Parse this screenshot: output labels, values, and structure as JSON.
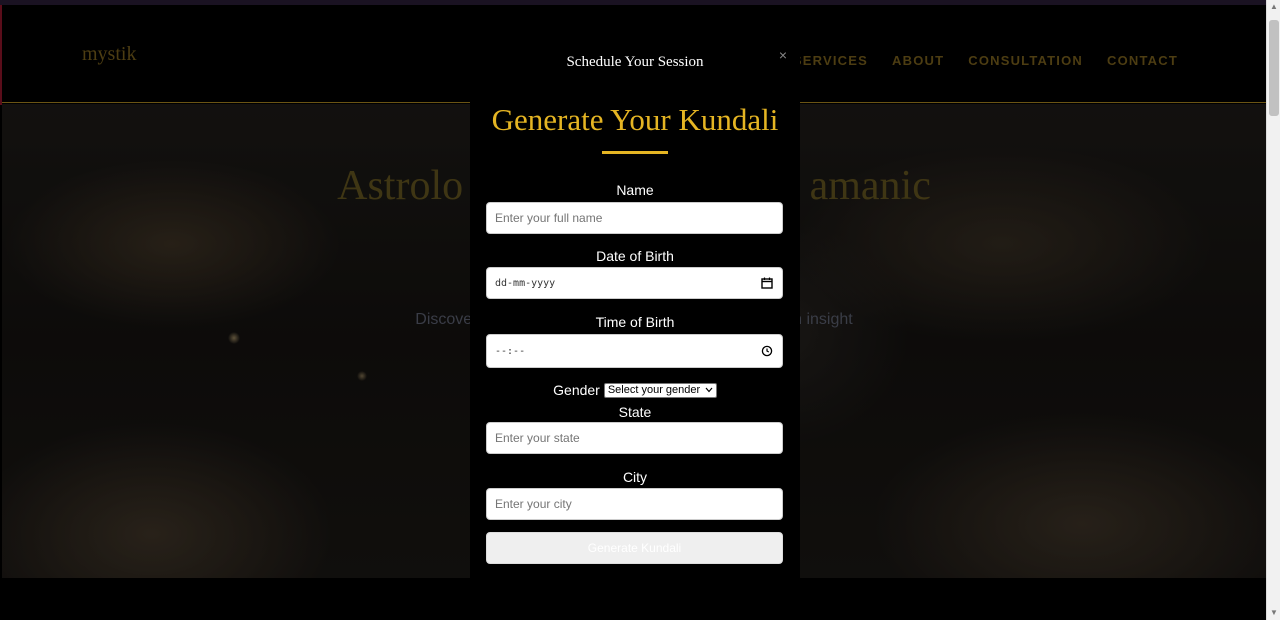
{
  "site": {
    "logo": "mystik",
    "nav": [
      "SERVICES",
      "ABOUT",
      "CONSULTATION",
      "CONTACT"
    ]
  },
  "hero": {
    "title": "Astrolo                                 amanic",
    "subtitle": "Discover y                                                                 ern insight"
  },
  "modal": {
    "title": "Schedule Your Session",
    "close": "×"
  },
  "form": {
    "heading": "Generate Your Kundali",
    "name_label": "Name",
    "name_placeholder": "Enter your full name",
    "dob_label": "Date of Birth",
    "dob_placeholder": "dd-mm-yyyy",
    "tob_label": "Time of Birth",
    "tob_placeholder": "--:--",
    "gender_label": "Gender",
    "gender_selected": "Select your gender",
    "state_label": "State",
    "state_placeholder": "Enter your state",
    "city_label": "City",
    "city_placeholder": "Enter your city",
    "submit_label": "Generate Kundali"
  },
  "icons": {
    "calendar": "calendar-icon",
    "clock": "clock-icon",
    "chevron": "chevron-down-icon",
    "close": "close-icon"
  },
  "colors": {
    "accent_gold": "#e5b523",
    "background": "#000000"
  }
}
